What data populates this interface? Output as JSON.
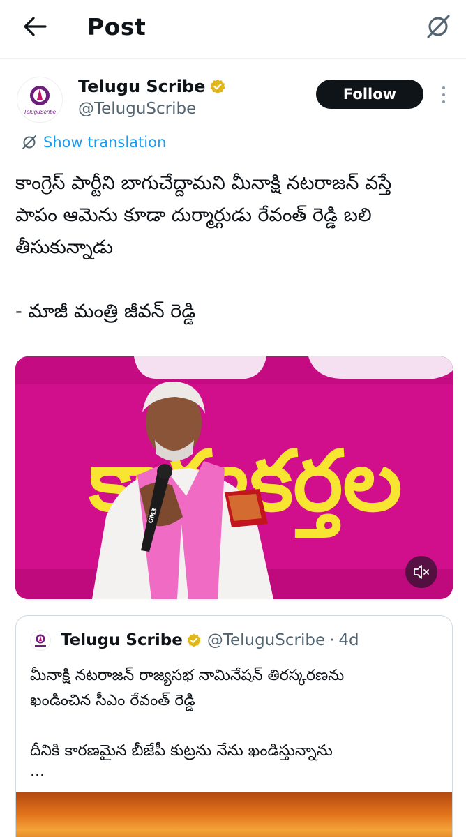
{
  "header": {
    "title": "Post"
  },
  "author": {
    "name": "Telugu Scribe",
    "handle": "@TeluguScribe",
    "avatar_caption": "TeluguScribe",
    "follow_label": "Follow"
  },
  "translation_label": "Show translation",
  "post": {
    "lines": [
      "కాంగ్రెస్ పార్టీని బాగుచేద్దామని మీనాక్షి నటరాజన్ వస్తే",
      "పాపం ఆమెను కూడా దుర్మార్గుడు రేవంత్ రెడ్డి బలి",
      "తీసుకున్నాడు"
    ],
    "attribution": "- మాజీ మంత్రి జీవన్ రెడ్డి"
  },
  "media": {
    "banner_text": "కార్యకర్తల",
    "mic_label": "GM3"
  },
  "quoted": {
    "name": "Telugu Scribe",
    "handle": "@TeluguScribe",
    "time": "4d",
    "lines": [
      "మీనాక్షి నటరాజన్ రాజ్యసభ నామినేషన్ తిరస్కరణను",
      "ఖండించిన సీఎం రేవంత్ రెడ్డి"
    ],
    "line3": "దీనికి కారణమైన బీజేపీ కుట్రను నేను ఖండిస్తున్నాను",
    "ellipsis": "..."
  },
  "colors": {
    "accent": "#1d9bf0",
    "verified": "#e2b719",
    "text": "#0f1419",
    "secondary": "#536471",
    "stage_pink": "#d4108f",
    "stage_yellow": "#f7e531"
  },
  "icons": {
    "back": "arrow-left-icon",
    "grok": "grok-icon",
    "verified": "verified-badge-icon",
    "translate": "grok-icon",
    "more": "more-vertical-icon",
    "mute": "mute-icon"
  }
}
